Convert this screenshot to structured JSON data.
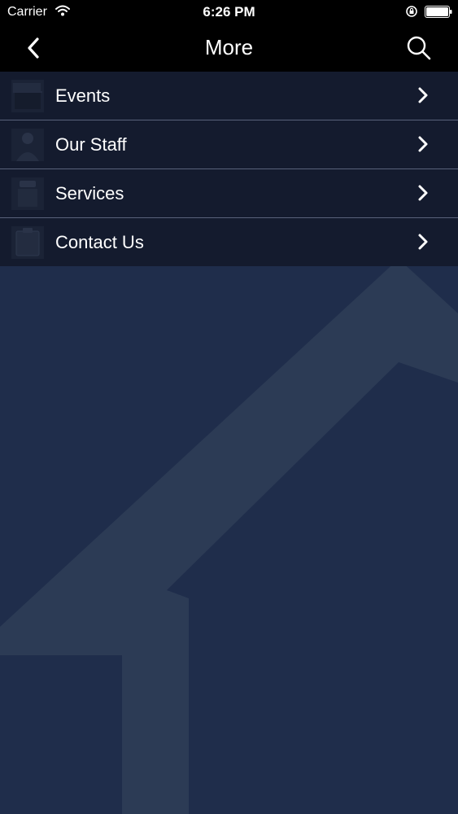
{
  "status_bar": {
    "carrier": "Carrier",
    "time": "6:26 PM"
  },
  "nav": {
    "title": "More",
    "back_icon": "chevron-left-icon",
    "search_icon": "search-icon"
  },
  "menu": {
    "items": [
      {
        "label": "Events",
        "icon": "events-thumbnail"
      },
      {
        "label": "Our Staff",
        "icon": "staff-thumbnail"
      },
      {
        "label": "Services",
        "icon": "services-thumbnail"
      },
      {
        "label": "Contact Us",
        "icon": "contact-thumbnail"
      }
    ]
  },
  "colors": {
    "bars": "#000000",
    "background": "#1f2d4b",
    "list_background": "#141b2e",
    "separator": "#59627a",
    "text": "#ffffff"
  }
}
